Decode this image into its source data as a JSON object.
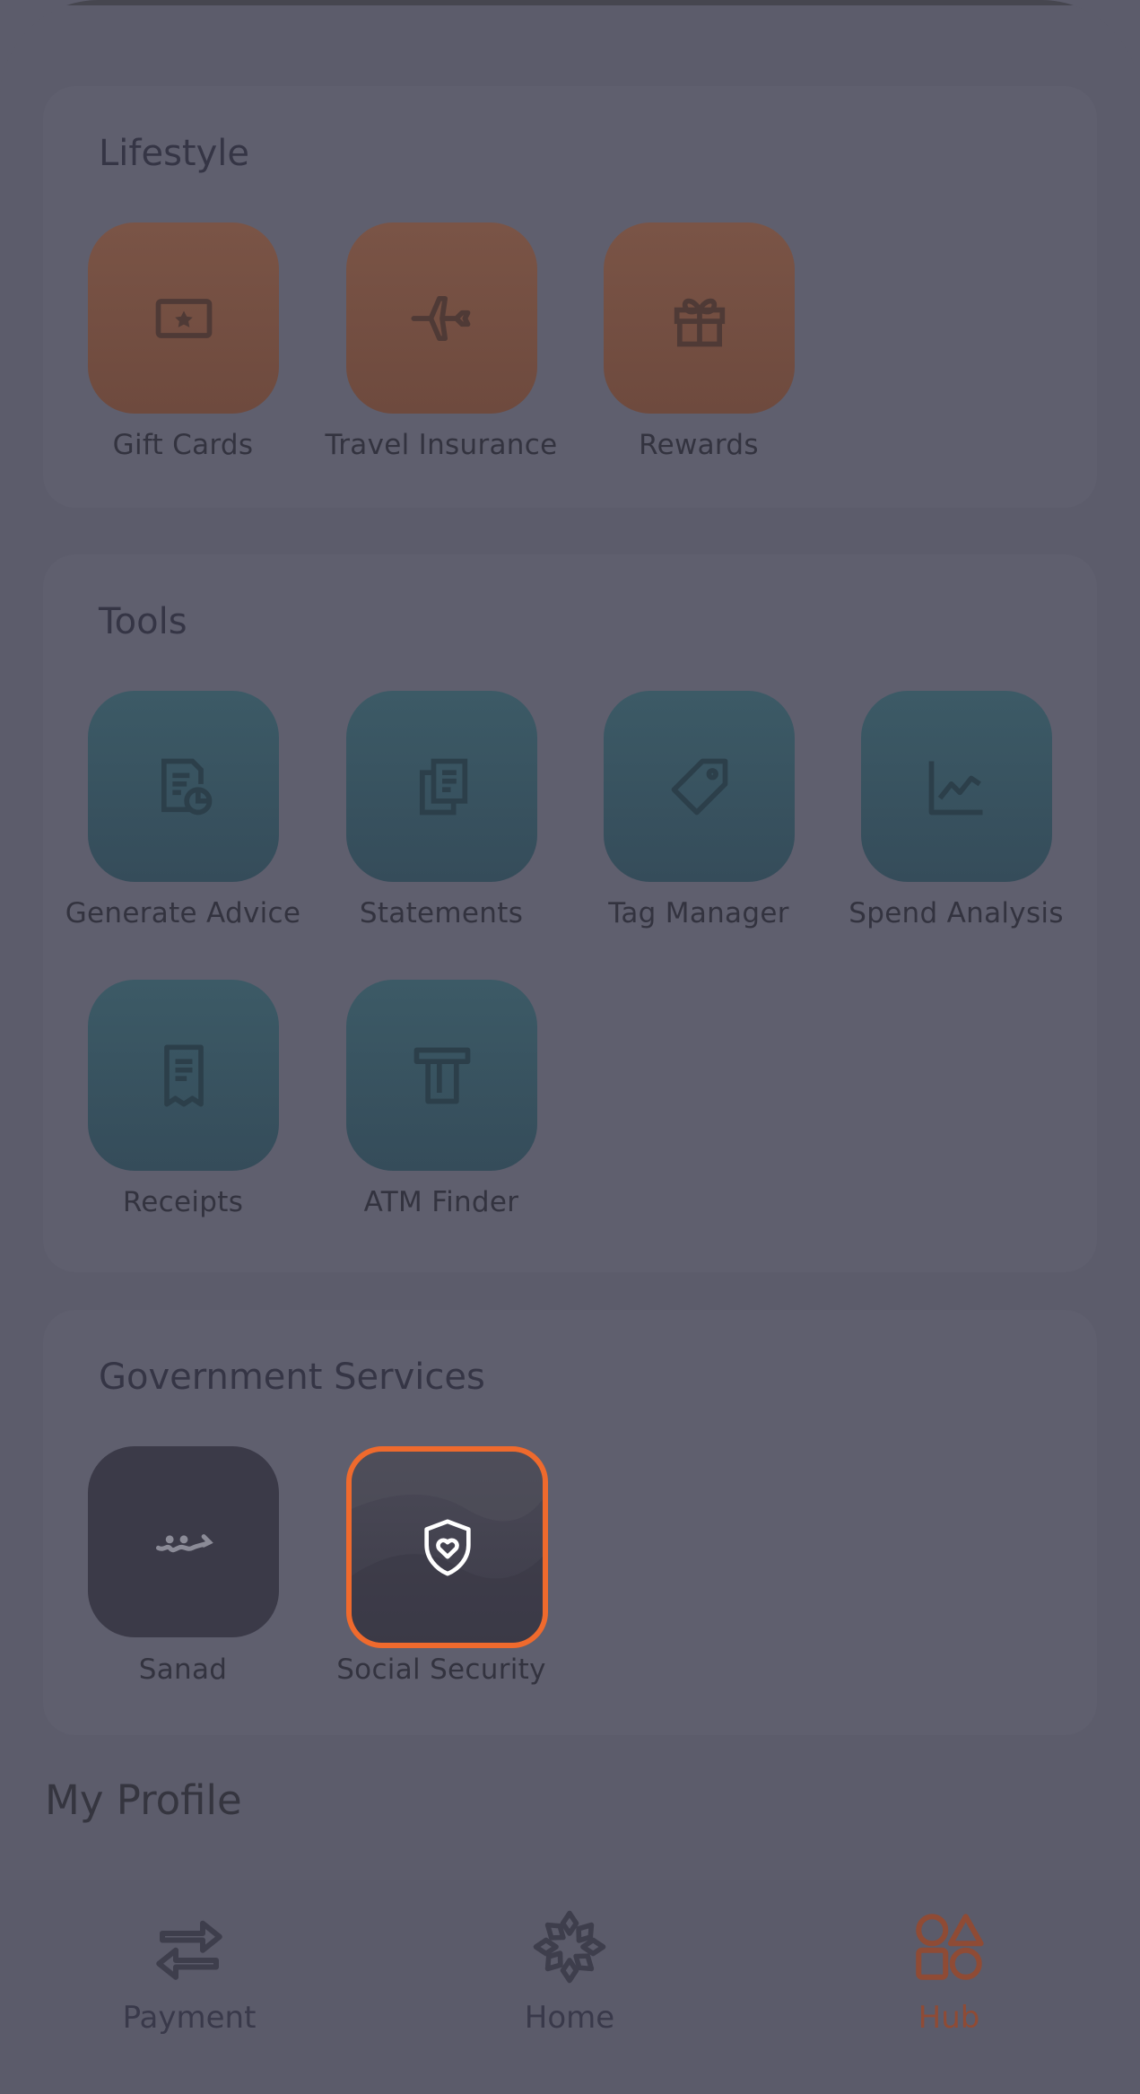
{
  "sections": {
    "lifestyle": {
      "title": "Lifestyle",
      "items": [
        {
          "label": "Gift Cards",
          "icon": "gift-card-icon"
        },
        {
          "label": "Travel Insurance",
          "icon": "airplane-icon"
        },
        {
          "label": "Rewards",
          "icon": "gift-icon"
        }
      ]
    },
    "tools": {
      "title": "Tools",
      "items": [
        {
          "label": "Generate Advice",
          "icon": "document-chart-icon"
        },
        {
          "label": "Statements",
          "icon": "documents-icon"
        },
        {
          "label": "Tag Manager",
          "icon": "tag-icon"
        },
        {
          "label": "Spend Analysis",
          "icon": "line-chart-icon"
        },
        {
          "label": "Receipts",
          "icon": "receipt-icon"
        },
        {
          "label": "ATM Finder",
          "icon": "atm-icon"
        }
      ]
    },
    "government": {
      "title": "Government Services",
      "items": [
        {
          "label": "Sanad",
          "icon": "sanad-logo-icon"
        },
        {
          "label": "Social Security",
          "icon": "shield-heart-icon"
        }
      ]
    }
  },
  "profile_heading": "My Profile",
  "nav": {
    "payment": "Payment",
    "home": "Home",
    "hub": "Hub",
    "active": "Hub"
  },
  "colors": {
    "highlight": "#ef6a2d",
    "lifestyle_tile": "#7a5446",
    "tools_tile": "#3c5a66",
    "gov_tile": "#3b3a48"
  }
}
